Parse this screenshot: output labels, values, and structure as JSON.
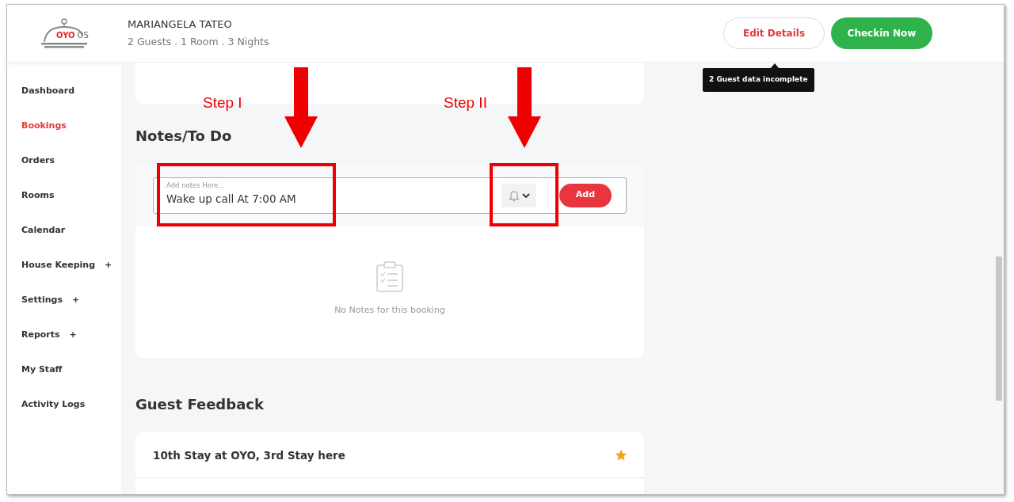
{
  "header": {
    "logo": {
      "brand": "OYO",
      "suffix": "OS"
    },
    "guest_name": "MARIANGELA TATEO",
    "summary": "2 Guests . 1 Room . 3 Nights",
    "buttons": [
      {
        "kind": "outline",
        "label": "Edit Details"
      },
      {
        "kind": "primary",
        "label": "Checkin Now"
      }
    ],
    "tooltip": "2 Guest data incomplete"
  },
  "sidebar": {
    "items": [
      {
        "label": "Dashboard",
        "selected": false
      },
      {
        "label": "Bookings",
        "selected": true
      },
      {
        "label": "Orders",
        "selected": false
      },
      {
        "label": "Rooms",
        "selected": false
      },
      {
        "label": "Calendar",
        "selected": false
      },
      {
        "label": "House Keeping",
        "selected": false,
        "toggle": "+"
      },
      {
        "label": "Settings",
        "selected": false,
        "toggle": "+"
      },
      {
        "label": "Reports",
        "selected": false,
        "toggle": "+"
      },
      {
        "label": "My Staff",
        "selected": false
      },
      {
        "label": "Activity Logs",
        "selected": false
      }
    ]
  },
  "notes": {
    "heading": "Notes/To Do",
    "input": {
      "placeholder": "Add notes Here...",
      "value": "Wake up call At 7:00 AM"
    },
    "add_button": "Add",
    "empty_text": "No Notes for this booking"
  },
  "feedback": {
    "heading": "Guest Feedback",
    "rows": [
      {
        "text": "10th Stay at OYO, 3rd Stay here",
        "starred": true
      }
    ]
  },
  "annotations": [
    {
      "label": "Step I"
    },
    {
      "label": "Step II"
    }
  ]
}
